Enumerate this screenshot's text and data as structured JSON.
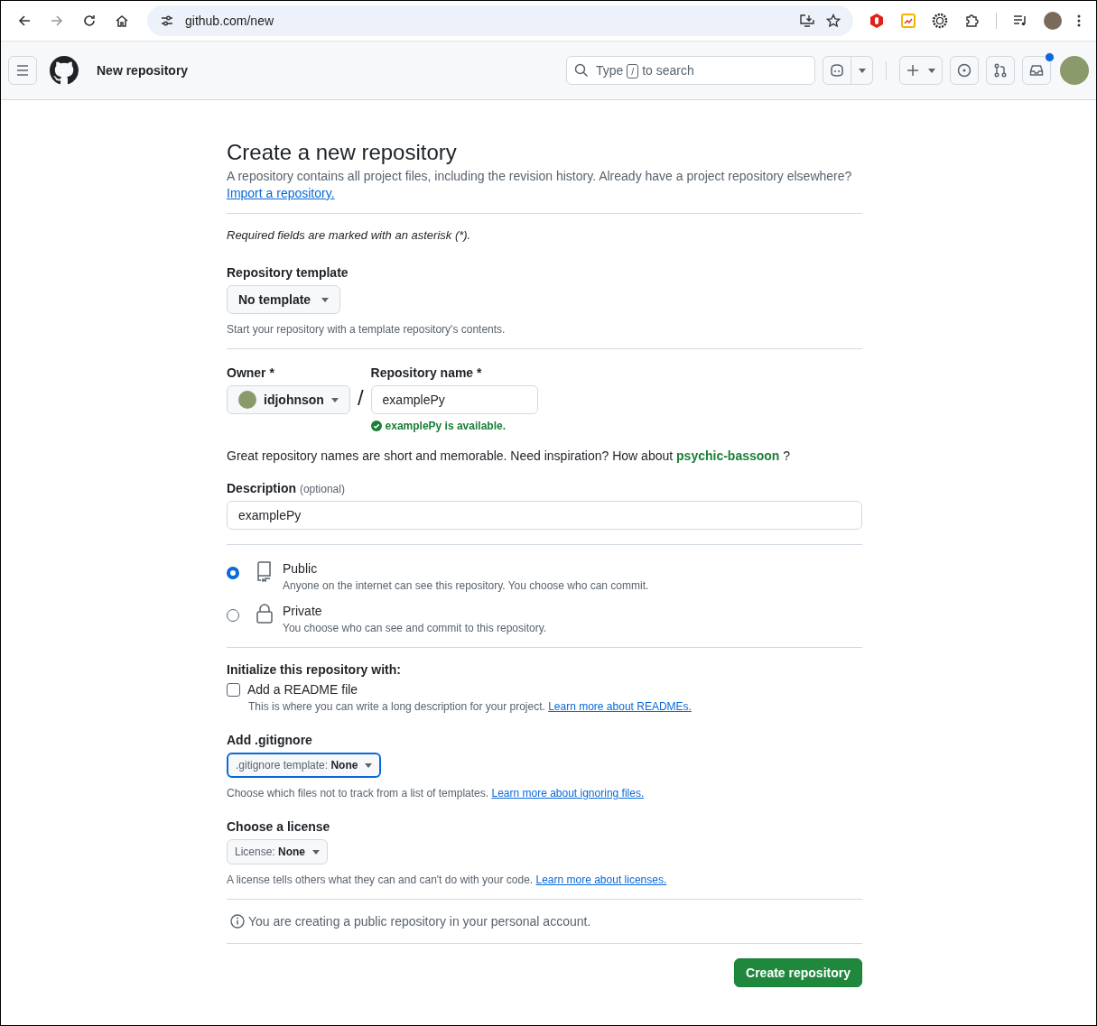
{
  "browser": {
    "url": "github.com/new"
  },
  "header": {
    "title": "New repository",
    "search": {
      "before": "Type",
      "key": "/",
      "after": "to search"
    },
    "inbox_unread": true
  },
  "form": {
    "heading": "Create a new repository",
    "intro": "A repository contains all project files, including the revision history. Already have a project repository elsewhere?",
    "import_link": "Import a repository.",
    "required_note": "Required fields are marked with an asterisk (*).",
    "template": {
      "label": "Repository template",
      "value": "No template",
      "hint": "Start your repository with a template repository's contents."
    },
    "owner": {
      "label": "Owner *",
      "value": "idjohnson"
    },
    "separator": "/",
    "repo_name": {
      "label": "Repository name *",
      "value": "examplePy",
      "status": "examplePy is available."
    },
    "suggestion": {
      "text": "Great repository names are short and memorable. Need inspiration? How about",
      "name": "psychic-bassoon",
      "tail": "?"
    },
    "description": {
      "label": "Description",
      "optional": "(optional)",
      "value": "examplePy"
    },
    "visibility": [
      {
        "kind": "public",
        "label": "Public",
        "description": "Anyone on the internet can see this repository. You choose who can commit.",
        "selected": true
      },
      {
        "kind": "private",
        "label": "Private",
        "description": "You choose who can see and commit to this repository.",
        "selected": false
      }
    ],
    "init": {
      "heading": "Initialize this repository with:",
      "readme": {
        "label": "Add a README file",
        "checked": false,
        "hint": "This is where you can write a long description for your project.",
        "link": "Learn more about READMEs."
      }
    },
    "gitignore": {
      "label": "Add .gitignore",
      "value": ".gitignore template: **None**",
      "focused": true,
      "hint": "Choose which files not to track from a list of templates.",
      "link": "Learn more about ignoring files."
    },
    "license": {
      "label": "Choose a license",
      "value": "License: **None**",
      "focused": false,
      "hint": "A license tells others what they can and can't do with your code.",
      "link": "Learn more about licenses."
    },
    "notice": "You are creating a public repository in your personal account.",
    "submit": "Create repository"
  }
}
